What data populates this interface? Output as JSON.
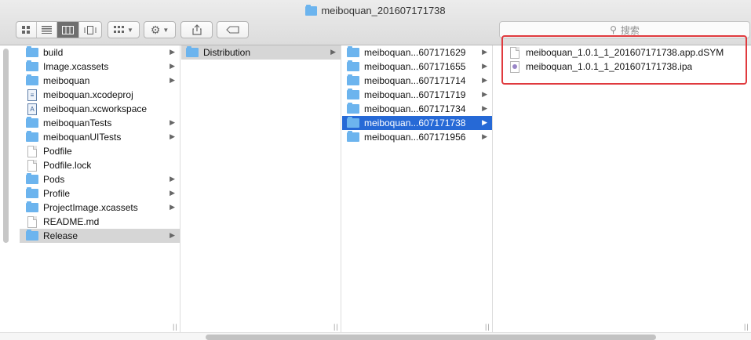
{
  "window": {
    "title": "meiboquan_201607171738"
  },
  "toolbar": {
    "view_icons": [
      "icon-view-icon",
      "list-view-icon",
      "column-view-icon",
      "coverflow-view-icon"
    ],
    "arrange_icon": "arrange-icon",
    "action_icon": "gear-icon",
    "share_icon": "share-icon",
    "tag_icon": "tag-icon"
  },
  "search": {
    "placeholder": "搜索"
  },
  "columns": {
    "col1": [
      {
        "label": "build",
        "type": "folder",
        "arrow": true
      },
      {
        "label": "Image.xcassets",
        "type": "folder",
        "arrow": true
      },
      {
        "label": "meiboquan",
        "type": "folder",
        "arrow": true
      },
      {
        "label": "meiboquan.xcodeproj",
        "type": "xcodeproj",
        "arrow": false
      },
      {
        "label": "meiboquan.xcworkspace",
        "type": "xcworkspace",
        "arrow": false
      },
      {
        "label": "meiboquanTests",
        "type": "folder",
        "arrow": true
      },
      {
        "label": "meiboquanUITests",
        "type": "folder",
        "arrow": true
      },
      {
        "label": "Podfile",
        "type": "doc",
        "arrow": false
      },
      {
        "label": "Podfile.lock",
        "type": "doc",
        "arrow": false
      },
      {
        "label": "Pods",
        "type": "folder",
        "arrow": true
      },
      {
        "label": "Profile",
        "type": "folder",
        "arrow": true
      },
      {
        "label": "ProjectImage.xcassets",
        "type": "folder",
        "arrow": true
      },
      {
        "label": "README.md",
        "type": "doc",
        "arrow": false
      },
      {
        "label": "Release",
        "type": "folder",
        "arrow": true
      }
    ],
    "col2": [
      {
        "label": "Distribution",
        "type": "folder",
        "arrow": true
      }
    ],
    "col3": [
      {
        "label": "meiboquan...607171629",
        "type": "folder",
        "arrow": true
      },
      {
        "label": "meiboquan...607171655",
        "type": "folder",
        "arrow": true
      },
      {
        "label": "meiboquan...607171714",
        "type": "folder",
        "arrow": true
      },
      {
        "label": "meiboquan...607171719",
        "type": "folder",
        "arrow": true
      },
      {
        "label": "meiboquan...607171734",
        "type": "folder",
        "arrow": true
      },
      {
        "label": "meiboquan...607171738",
        "type": "folder",
        "arrow": true
      },
      {
        "label": "meiboquan...607171956",
        "type": "folder",
        "arrow": true
      }
    ],
    "col4": [
      {
        "label": "meiboquan_1.0.1_1_201607171738.app.dSYM",
        "type": "doc",
        "arrow": false
      },
      {
        "label": "meiboquan_1.0.1_1_201607171738.ipa",
        "type": "ipa",
        "arrow": false
      }
    ]
  },
  "selection": {
    "col1_selected": "Release",
    "col2_selected": "Distribution",
    "col3_selected": "meiboquan...607171738"
  },
  "colors": {
    "selection_blue": "#2669d6",
    "selection_gray": "#d6d6d6",
    "folder": "#6cb4ee",
    "highlight_box": "#e03a3e"
  }
}
